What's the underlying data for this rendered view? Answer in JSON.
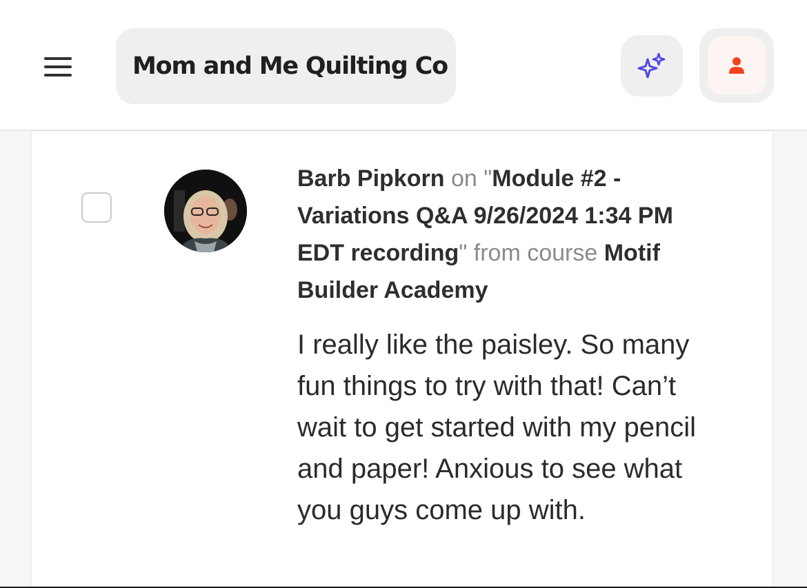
{
  "header": {
    "title": "Mom and Me Quilting Co",
    "menu_icon": "hamburger-menu-icon",
    "ai_icon": "sparkles-icon",
    "user_icon": "person-icon",
    "colors": {
      "ai_accent": "#4f46e5",
      "user_accent": "#f0441f"
    }
  },
  "comment": {
    "author": "Barb Pipkorn",
    "on_word": "on",
    "quote_open": "\"",
    "lesson_title": "Module #2 - Variations Q&A 9/26/2024 1:34 PM EDT recording",
    "quote_close": "\"",
    "from_course_text": "from course",
    "course_name": "Motif Builder Academy",
    "body": "I really like the paisley. So many fun things to try with that! Can’t wait to get started with my pencil and paper! Anxious to see what you guys come up with."
  }
}
